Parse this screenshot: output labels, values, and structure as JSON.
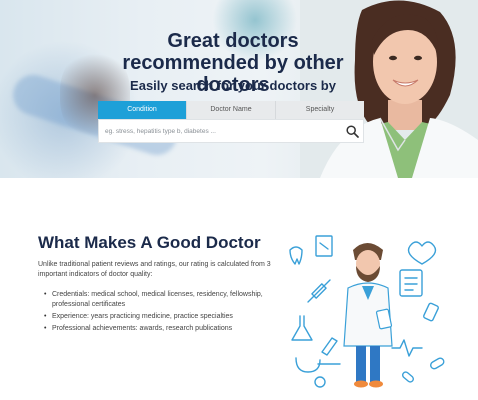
{
  "hero": {
    "title": "Great doctors recommended by other doctors",
    "subtitle": "Easily search for your doctors by",
    "tabs": [
      {
        "label": "Condition",
        "active": true
      },
      {
        "label": "Doctor Name",
        "active": false
      },
      {
        "label": "Specialty",
        "active": false
      }
    ],
    "search": {
      "value": "",
      "placeholder": "eg. stress, hepatitis type b, diabetes ..."
    }
  },
  "content": {
    "title": "What Makes A Good Doctor",
    "intro": "Unlike traditional patient reviews and ratings, our rating is calculated from 3 important indicators of doctor quality:",
    "criteria": [
      "Credentials: medical school, medical licenses, residency, fellowship, professional certificates",
      "Experience: years practicing medicine, practice specialties",
      "Professional achievements: awards, research publications"
    ]
  },
  "colors": {
    "accent": "#1ea0d8",
    "heading": "#1b2a4a",
    "illustration_line": "#3aa0d8",
    "illustration_accent": "#f08a3c"
  },
  "icons": [
    "search-icon",
    "doctor-illustration",
    "tooth-icon",
    "heart-icon",
    "clipboard-icon",
    "syringe-icon",
    "flask-icon",
    "stethoscope-icon",
    "pill-icon",
    "microscope-icon",
    "pulse-icon",
    "bottle-icon"
  ]
}
